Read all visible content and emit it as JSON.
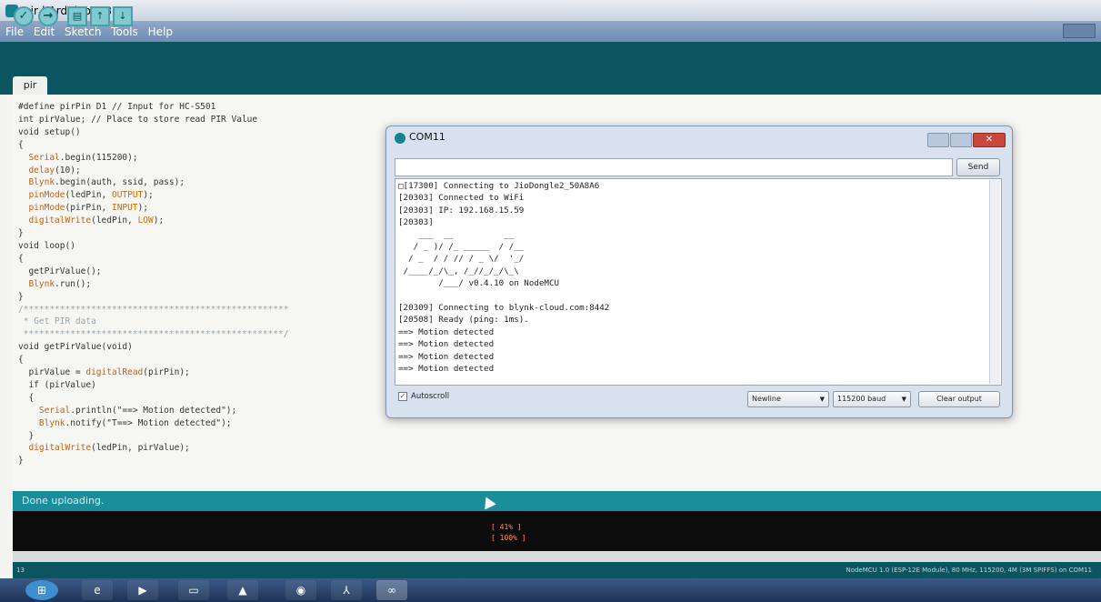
{
  "window": {
    "title": "pir | Arduino 1.8.4"
  },
  "menu": {
    "items": [
      "File",
      "Edit",
      "Sketch",
      "Tools",
      "Help"
    ]
  },
  "toolbar": {
    "buttons": [
      {
        "name": "verify",
        "icon": "checkmark-icon",
        "glyph": "✓"
      },
      {
        "name": "upload",
        "icon": "arrow-right-icon",
        "glyph": "→"
      },
      {
        "name": "new",
        "icon": "new-file-icon",
        "glyph": "▤"
      },
      {
        "name": "open",
        "icon": "open-icon",
        "glyph": "↑"
      },
      {
        "name": "save",
        "icon": "save-icon",
        "glyph": "↓"
      }
    ]
  },
  "tabs": [
    {
      "label": "pir"
    }
  ],
  "code_lines": [
    "#define pirPin D1 // Input for HC-S501",
    "int pirValue; // Place to store read PIR Value",
    "void setup()",
    "{",
    "  Serial.begin(115200);",
    "  delay(10);",
    "  Blynk.begin(auth, ssid, pass);",
    "  pinMode(ledPin, OUTPUT);",
    "  pinMode(pirPin, INPUT);",
    "  digitalWrite(ledPin, LOW);",
    "}",
    "void loop()",
    "{",
    "  getPirValue();",
    "  Blynk.run();",
    "}",
    "/***************************************************",
    " * Get PIR data",
    " **************************************************/",
    "void getPirValue(void)",
    "{",
    "  pirValue = digitalRead(pirPin);",
    "  if (pirValue)",
    "  {",
    "    Serial.println(\"==> Motion detected\");",
    "    Blynk.notify(\"T==> Motion detected\");",
    "  }",
    "  digitalWrite(ledPin, pirValue);",
    "}"
  ],
  "status": {
    "message": "Done uploading."
  },
  "console": {
    "lines": [
      "[ 41% ]",
      "[ 100% ]"
    ]
  },
  "footer": {
    "line": "13",
    "board": "NodeMCU 1.0 (ESP-12E Module), 80 MHz, 115200, 4M (3M SPIFFS) on COM11"
  },
  "serial_monitor": {
    "title": "COM11",
    "send_label": "Send",
    "input_value": "",
    "output_lines": [
      "□[17300] Connecting to JioDongle2_50A8A6",
      "[20303] Connected to WiFi",
      "[20303] IP: 192.168.15.59",
      "[20303]",
      "    ___  __          __",
      "   / _ )/ /_ _____  / /__",
      "  / _  / / // / _ \\/  '_/",
      " /____/_/\\_, /_//_/_/\\_\\",
      "        /___/ v0.4.10 on NodeMCU",
      "",
      "[20309] Connecting to blynk-cloud.com:8442",
      "[20508] Ready (ping: 1ms).",
      "==> Motion detected",
      "==> Motion detected",
      "==> Motion detected",
      "==> Motion detected"
    ],
    "autoscroll_label": "Autoscroll",
    "autoscroll_checked": true,
    "line_ending": "Newline",
    "baud": "115200 baud",
    "clear_label": "Clear output"
  },
  "taskbar": {
    "apps": [
      "start-orb-icon",
      "ie-icon",
      "media-player-icon",
      "folder-icon",
      "vlc-icon",
      "user-icon",
      "chrome-icon",
      "acrobat-icon",
      "arduino-icon"
    ]
  },
  "colors": {
    "teal": "#0b5560",
    "status_teal": "#1a8f9b",
    "orange": "#cc6a00"
  }
}
